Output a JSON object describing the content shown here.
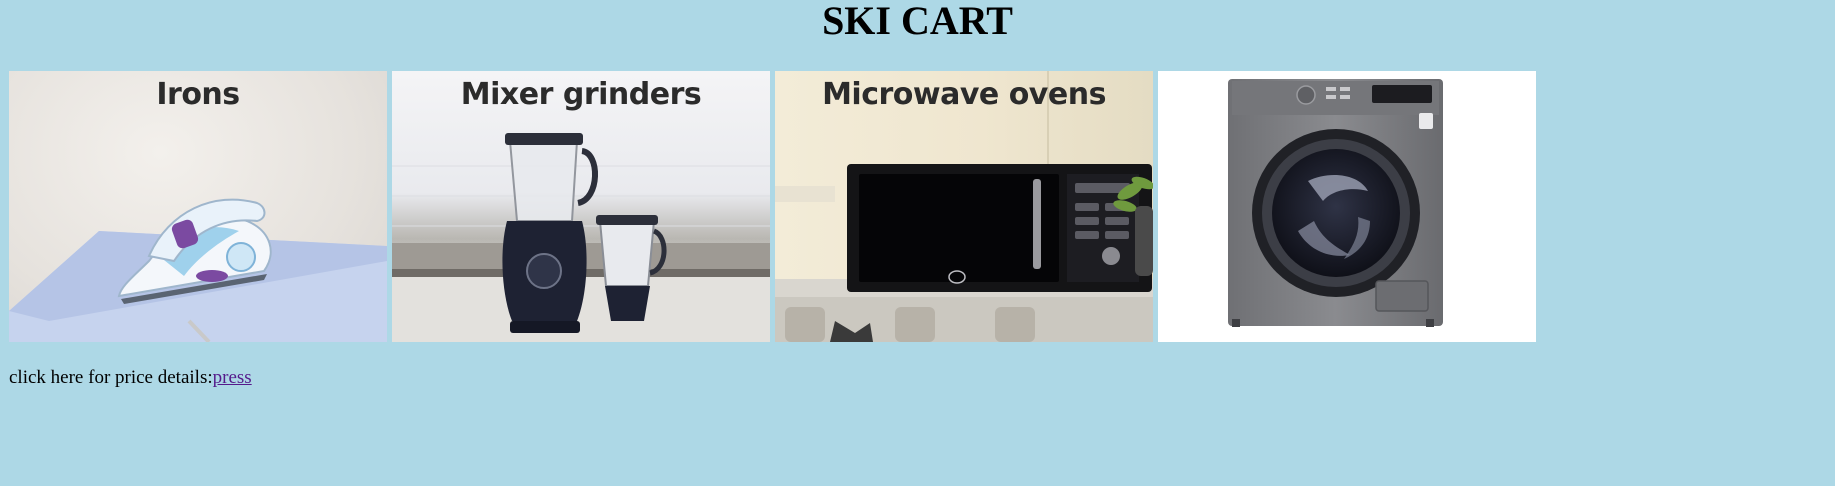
{
  "page": {
    "title": "SKI CART"
  },
  "products": [
    {
      "caption": "Irons",
      "icon": "iron-icon"
    },
    {
      "caption": "Mixer grinders",
      "icon": "mixer-grinder-icon"
    },
    {
      "caption": "Microwave ovens",
      "icon": "microwave-oven-icon"
    },
    {
      "caption": "",
      "icon": "washing-machine-icon"
    }
  ],
  "footer": {
    "price_text": "click here for price details:",
    "link_text": "press"
  },
  "colors": {
    "background": "#add8e6",
    "link": "#551a8b"
  }
}
